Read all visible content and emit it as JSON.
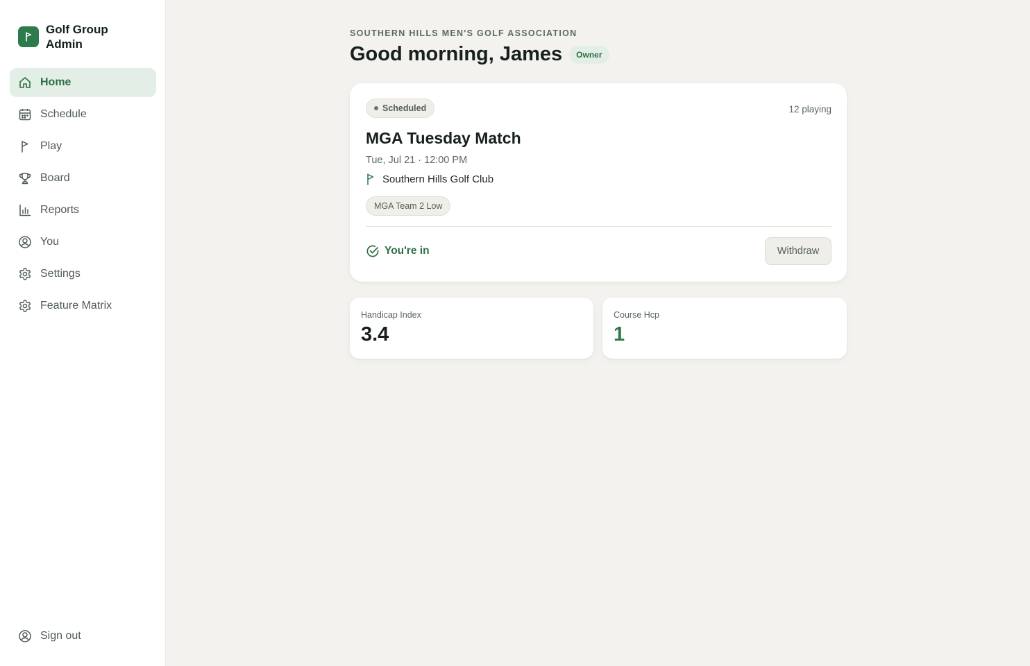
{
  "brand": {
    "name": "Golf Group Admin",
    "logo_icon": "flag-icon"
  },
  "nav": {
    "items": [
      {
        "label": "Home",
        "icon": "home-icon",
        "active": true
      },
      {
        "label": "Schedule",
        "icon": "calendar-icon",
        "active": false
      },
      {
        "label": "Play",
        "icon": "flag-icon",
        "active": false
      },
      {
        "label": "Board",
        "icon": "trophy-icon",
        "active": false
      },
      {
        "label": "Reports",
        "icon": "bar-chart-icon",
        "active": false
      },
      {
        "label": "You",
        "icon": "user-circle-icon",
        "active": false
      },
      {
        "label": "Settings",
        "icon": "gear-icon",
        "active": false
      },
      {
        "label": "Feature Matrix",
        "icon": "gear-icon",
        "active": false
      }
    ],
    "signout": {
      "label": "Sign out",
      "icon": "user-circle-icon"
    }
  },
  "header": {
    "org": "SOUTHERN HILLS MEN'S GOLF ASSOCIATION",
    "greeting": "Good morning, James",
    "role": "Owner"
  },
  "event": {
    "status": "Scheduled",
    "playing": "12 playing",
    "name": "MGA Tuesday Match",
    "datetime": "Tue, Jul 21 · 12:00 PM",
    "course": "Southern Hills Golf Club",
    "format": "MGA Team 2 Low",
    "rsvp": "You're in",
    "withdraw_label": "Withdraw"
  },
  "stats": [
    {
      "label": "Handicap Index",
      "value": "3.4"
    },
    {
      "label": "Course Hcp",
      "value": "1"
    }
  ],
  "colors": {
    "accent": "#2d7a4a",
    "accent_soft": "#e3efe6",
    "background": "#f3f2ee"
  }
}
